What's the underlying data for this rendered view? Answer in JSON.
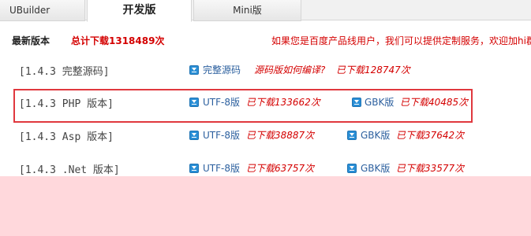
{
  "tabs": [
    {
      "label": "UBuilder"
    },
    {
      "label": "开发版"
    },
    {
      "label": "Mini版"
    }
  ],
  "header": {
    "title": "最新版本",
    "total": "总计下载1318489次",
    "notice": "如果您是百度产品线用户，我们可以提供定制服务，欢迎加hi群"
  },
  "rows": [
    {
      "label": "[1.4.3 完整源码]",
      "link1": "完整源码",
      "note1": "源码版如何编译?",
      "count1": "已下载128747次"
    },
    {
      "label": "[1.4.3 PHP 版本]",
      "link1": "UTF-8版",
      "count1": "已下载133662次",
      "link2": "GBK版",
      "count2": "已下载40485次"
    },
    {
      "label": "[1.4.3 Asp 版本]",
      "link1": "UTF-8版",
      "count1": "已下载38887次",
      "link2": "GBK版",
      "count2": "已下载37642次"
    },
    {
      "label": "[1.4.3 .Net 版本]",
      "link1": "UTF-8版",
      "count1": "已下载63757次",
      "link2": "GBK版",
      "count2": "已下载33577次"
    }
  ],
  "colors": {
    "accent_red": "#d40000",
    "link_blue": "#2b5f9e",
    "highlight_border": "#e0383e",
    "overlay_pink": "#ffd8dc"
  }
}
